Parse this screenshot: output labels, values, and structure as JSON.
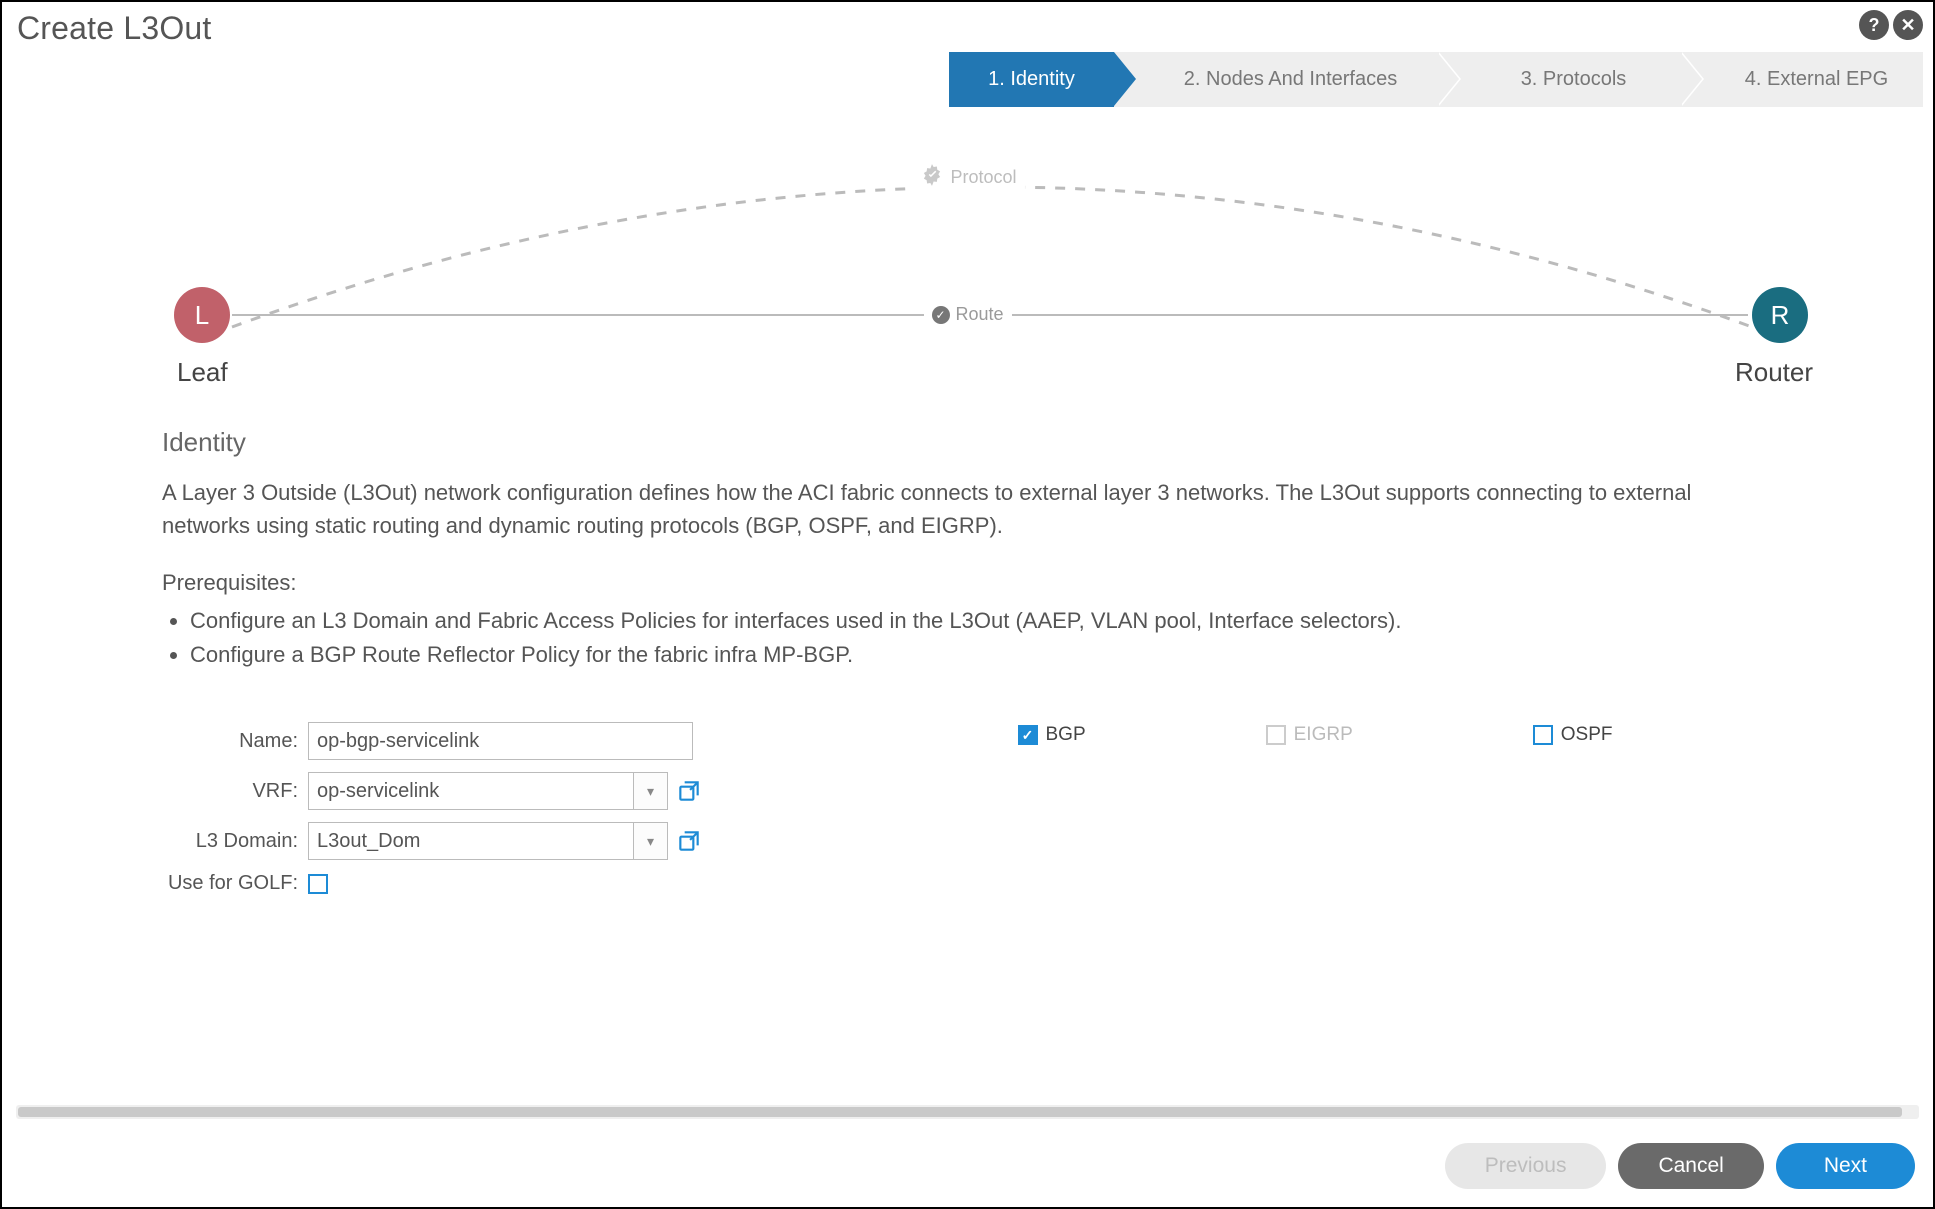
{
  "dialog": {
    "title": "Create L3Out"
  },
  "stepper": {
    "steps": [
      {
        "label": "1. Identity",
        "active": true
      },
      {
        "label": "2. Nodes And Interfaces",
        "active": false
      },
      {
        "label": "3. Protocols",
        "active": false
      },
      {
        "label": "4. External EPG",
        "active": false
      }
    ]
  },
  "diagram": {
    "leaf_letter": "L",
    "leaf_label": "Leaf",
    "router_letter": "R",
    "router_label": "Router",
    "route_label": "Route",
    "protocol_label": "Protocol"
  },
  "identity": {
    "section_title": "Identity",
    "description": "A Layer 3 Outside (L3Out) network configuration defines how the ACI fabric connects to external layer 3 networks. The L3Out supports connecting to external networks using static routing and dynamic routing protocols (BGP, OSPF, and EIGRP).",
    "prereq_title": "Prerequisites:",
    "prereq_items": [
      "Configure an L3 Domain and Fabric Access Policies for interfaces used in the L3Out (AAEP, VLAN pool, Interface selectors).",
      "Configure a BGP Route Reflector Policy for the fabric infra MP-BGP."
    ]
  },
  "form": {
    "name_label": "Name:",
    "name_value": "op-bgp-servicelink",
    "vrf_label": "VRF:",
    "vrf_value": "op-servicelink",
    "l3domain_label": "L3 Domain:",
    "l3domain_value": "L3out_Dom",
    "golf_label": "Use for GOLF:",
    "protocols": {
      "bgp": "BGP",
      "eigrp": "EIGRP",
      "ospf": "OSPF"
    }
  },
  "footer": {
    "previous": "Previous",
    "cancel": "Cancel",
    "next": "Next"
  }
}
